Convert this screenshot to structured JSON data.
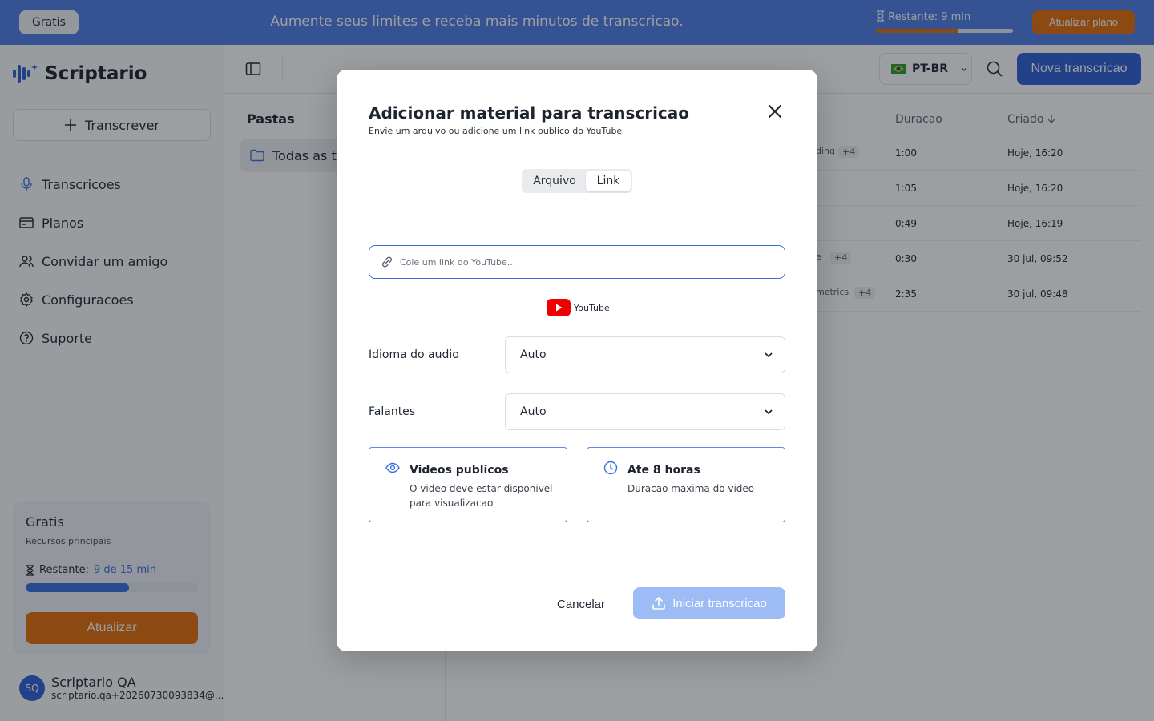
{
  "banner": {
    "plan_pill": "Gratis",
    "promo": "Aumente seus limites e receba mais minutos de transcricao.",
    "remaining_label": "Restante:",
    "remaining_value": "9 min",
    "remaining_fraction": 0.6,
    "upgrade_button": "Atualizar plano"
  },
  "sidebar": {
    "app_name": "Scriptario",
    "transcribe_button": "Transcrever",
    "nav": [
      {
        "label": "Transcricoes",
        "icon": "microphone-icon"
      },
      {
        "label": "Planos",
        "icon": "credit-card-icon"
      },
      {
        "label": "Convidar um amigo",
        "icon": "users-icon"
      },
      {
        "label": "Configuracoes",
        "icon": "gear-icon"
      },
      {
        "label": "Suporte",
        "icon": "help-circle-icon"
      }
    ],
    "plan_card": {
      "name": "Gratis",
      "description": "Recursos principais",
      "remaining_label": "Restante:",
      "remaining_value": "9 de 15 min",
      "remaining_fraction": 0.6,
      "button": "Atualizar"
    },
    "user": {
      "initials": "SQ",
      "name": "Scriptario QA",
      "email": "scriptario.qa+20260730093834@..."
    }
  },
  "header": {
    "language": "PT-BR",
    "new_button": "Nova transcricao"
  },
  "folders": {
    "title": "Pastas",
    "items": [
      "Todas as tra"
    ]
  },
  "table": {
    "columns": {
      "duration": "Duracao",
      "created": "Criado"
    },
    "rows": [
      {
        "tag": "ding",
        "more": "+4",
        "duration": "1:00",
        "created": "Hoje, 16:20"
      },
      {
        "tag": "",
        "more": "",
        "duration": "1:05",
        "created": "Hoje, 16:20"
      },
      {
        "tag": "",
        "more": "",
        "duration": "0:49",
        "created": "Hoje, 16:19"
      },
      {
        "tag": "e",
        "more": "+4",
        "duration": "0:30",
        "created": "30 jul, 09:52"
      },
      {
        "tag": "metrics",
        "more": "+4",
        "duration": "2:35",
        "created": "30 jul, 09:48"
      }
    ]
  },
  "modal": {
    "title": "Adicionar material para transcricao",
    "subtitle": "Envie um arquivo ou adicione um link publico do YouTube",
    "tabs": [
      "Arquivo",
      "Link"
    ],
    "active_tab": "Link",
    "link_value": "",
    "link_placeholder": "Cole um link do YouTube...",
    "youtube_label": "YouTube",
    "audio_language_label": "Idioma do audio",
    "audio_language_value": "Auto",
    "speakers_label": "Falantes",
    "speakers_value": "Auto",
    "cards": [
      {
        "title": "Videos publicos",
        "description": "O video deve estar disponivel para visualizacao",
        "icon": "eye-icon"
      },
      {
        "title": "Ate 8 horas",
        "description": "Duracao maxima do video",
        "icon": "clock-icon"
      }
    ],
    "cancel_button": "Cancelar",
    "start_button": "Iniciar transcricao"
  },
  "colors": {
    "banner": "#4f7fe6",
    "accent_orange": "#e36d0a",
    "primary_blue": "#2f5fd6",
    "disabled_blue": "#9dbcf5"
  }
}
